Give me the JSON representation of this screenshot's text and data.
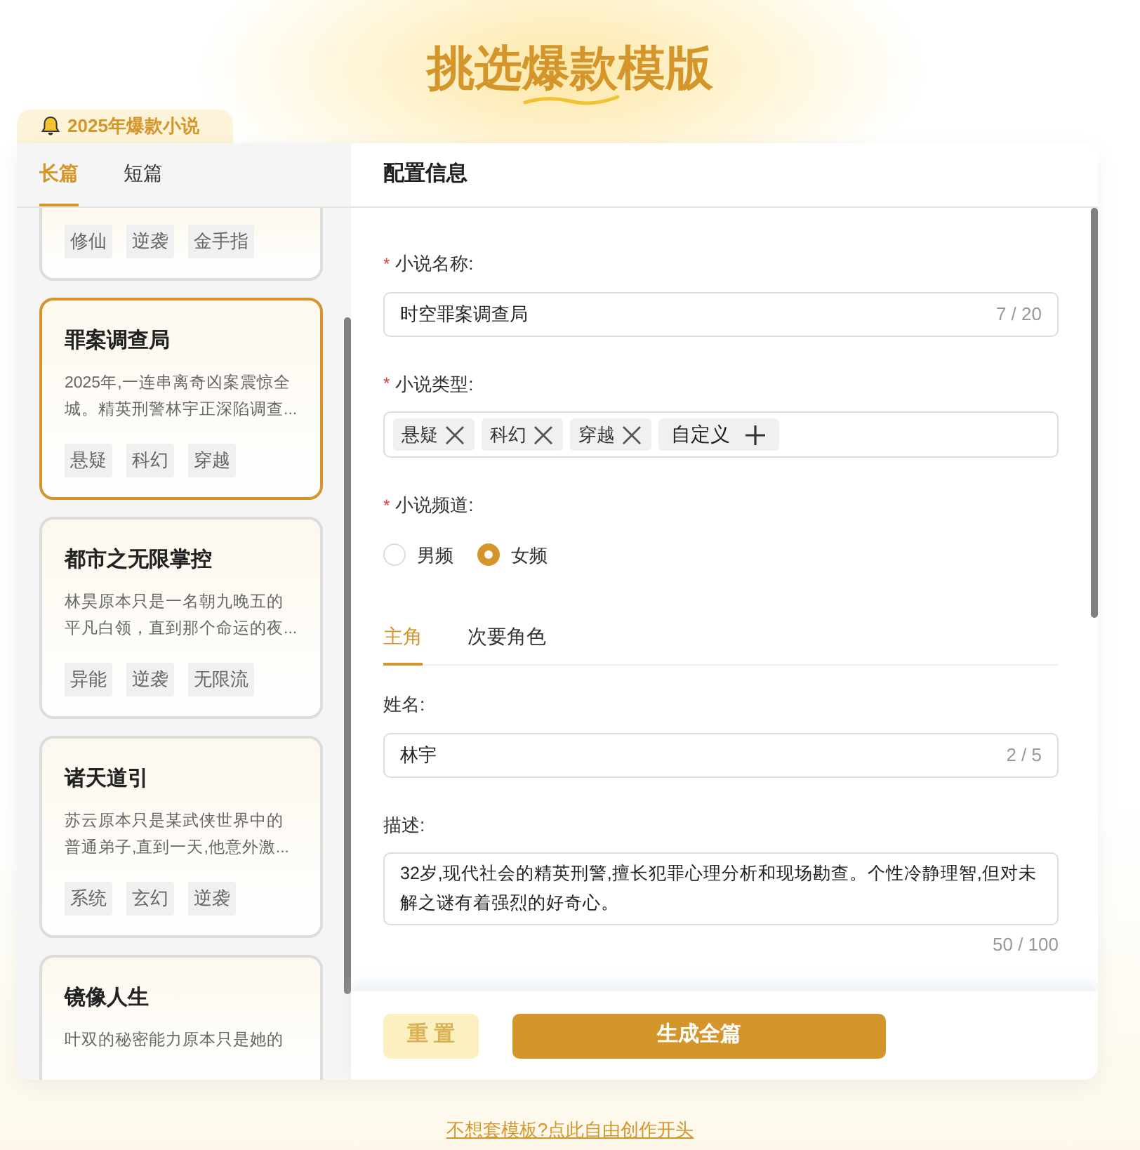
{
  "title": {
    "before": "挑选",
    "highlight": "爆款",
    "after": "模版"
  },
  "badge": "2025年爆款小说",
  "length_tabs": [
    {
      "label": "长篇",
      "selected": true
    },
    {
      "label": "短篇",
      "selected": false
    }
  ],
  "novels": [
    {
      "tags": [
        "修仙",
        "逆袭",
        "金手指"
      ],
      "selected": false
    },
    {
      "title": "罪案调查局",
      "description": "2025年,一连串离奇凶案震惊全城。精英刑警林宇正深陷调查...",
      "tags": [
        "悬疑",
        "科幻",
        "穿越"
      ],
      "selected": true
    },
    {
      "title": "都市之无限掌控",
      "description": "林昊原本只是一名朝九晚五的平凡白领，直到那个命运的夜...",
      "tags": [
        "异能",
        "逆袭",
        "无限流"
      ],
      "selected": false
    },
    {
      "title": "诸天道引",
      "description": "苏云原本只是某武侠世界中的普通弟子,直到一天,他意外激...",
      "tags": [
        "系统",
        "玄幻",
        "逆袭"
      ],
      "selected": false
    },
    {
      "title": "镜像人生",
      "description": "叶双的秘密能力原本只是她的",
      "selected": false
    }
  ],
  "config": {
    "title": "配置信息",
    "name_field": {
      "label": "小说名称:",
      "required_mark": "*",
      "value": "时空罪案调查局",
      "count": "7 / 20"
    },
    "type_field": {
      "label": "小说类型:",
      "required_mark": "*",
      "chips": [
        {
          "kind": "tag",
          "label": "悬疑"
        },
        {
          "kind": "tag",
          "label": "科幻"
        },
        {
          "kind": "tag",
          "label": "穿越"
        },
        {
          "kind": "add",
          "label": "自定义"
        }
      ]
    },
    "channel_field": {
      "label": "小说频道:",
      "required_mark": "*",
      "options": [
        {
          "label": "男频",
          "selected": false
        },
        {
          "label": "女频",
          "selected": true
        }
      ]
    },
    "role_tabs": [
      {
        "label": "主角",
        "selected": true
      },
      {
        "label": "次要角色",
        "selected": false
      }
    ],
    "character_name": {
      "label": "姓名:",
      "value": "林宇",
      "count": "2 / 5"
    },
    "character_description": {
      "label": "描述:",
      "value": "32岁,现代社会的精英刑警,擅长犯罪心理分析和现场勘查。个性冷静理智,但对未解之谜有着强烈的好奇心。",
      "count": "50 / 100"
    }
  },
  "buttons": {
    "reset": "重 置",
    "generate": "生成全篇"
  },
  "footer_link": "不想套模板?点此自由创作开头"
}
